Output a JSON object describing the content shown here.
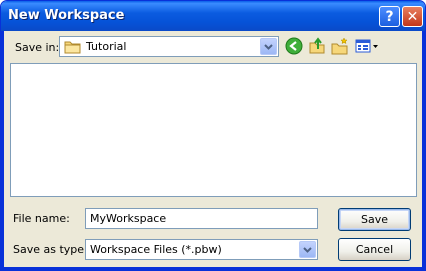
{
  "window": {
    "title": "New Workspace",
    "help_label": "?",
    "close_label": "✕"
  },
  "toolbar": {
    "save_in_label": "Save in:",
    "save_in_value": "Tutorial",
    "icons": [
      "back-icon",
      "up-folder-icon",
      "new-folder-icon",
      "view-menu-icon"
    ]
  },
  "file_name": {
    "label": "File name:",
    "value": "MyWorkspace"
  },
  "save_as_type": {
    "label": "Save as type:",
    "value": "Workspace Files (*.pbw)"
  },
  "buttons": {
    "save": "Save",
    "cancel": "Cancel"
  },
  "colors": {
    "titlebar": "#0a5fe8",
    "dialog_bg": "#ece9d8",
    "field_border": "#7f9db9",
    "button_border": "#003c74"
  }
}
